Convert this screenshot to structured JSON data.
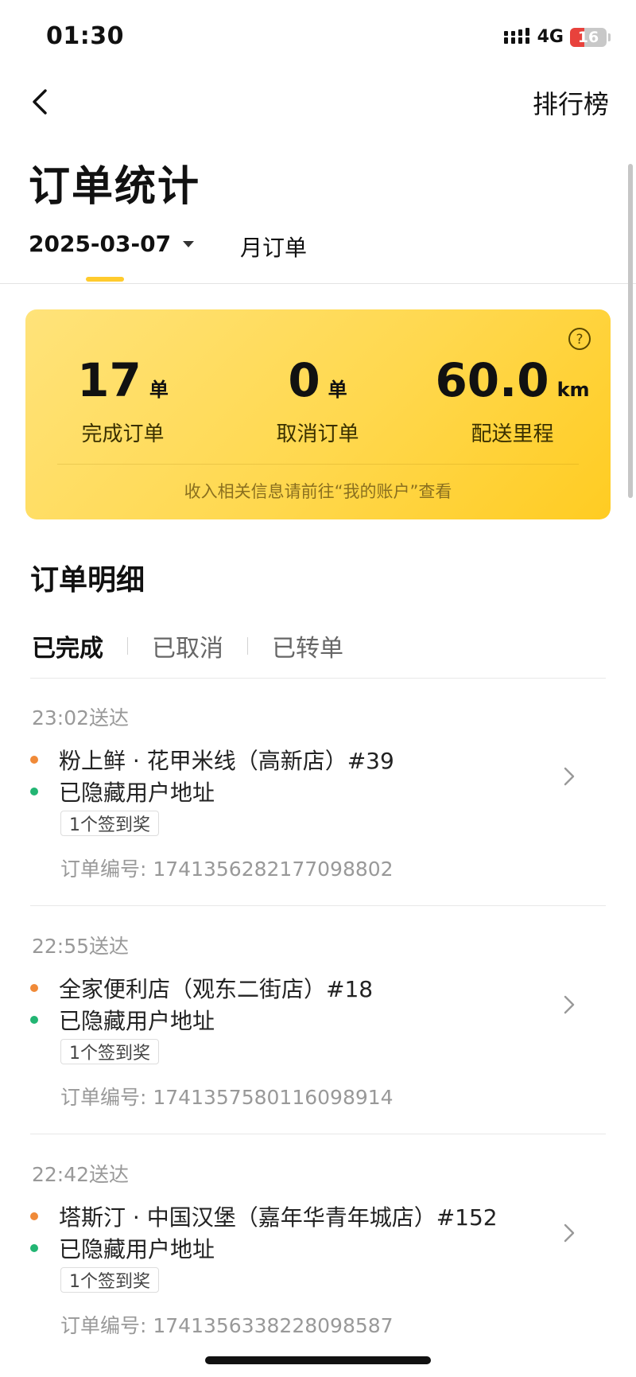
{
  "status_bar": {
    "time": "01:30",
    "network": "4G",
    "battery": "16",
    "battery_level": 0.16,
    "colors": {
      "battery_low": "#e8423c"
    }
  },
  "nav": {
    "back_icon": "chevron-left-icon",
    "ranking_label": "排行榜"
  },
  "page": {
    "title": "订单统计"
  },
  "tabs": {
    "date": "2025-03-07",
    "month": "月订单",
    "active": "date",
    "accent_color": "#ffcb2d"
  },
  "summary": {
    "stats": [
      {
        "value": "17",
        "unit": "单",
        "label": "完成订单"
      },
      {
        "value": "0",
        "unit": "单",
        "label": "取消订单"
      },
      {
        "value": "60.0",
        "unit": "km",
        "label": "配送里程"
      }
    ],
    "note": "收入相关信息请前往“我的账户”查看",
    "help_icon": "question-circle-icon",
    "card_color": "#ffd84e"
  },
  "detail": {
    "title": "订单明细",
    "filters": [
      "已完成",
      "已取消",
      "已转单"
    ],
    "active_filter": 0
  },
  "orders": [
    {
      "time": "23:02送达",
      "store": "粉上鲜 · 花甲米线（高新店）#39",
      "address": "已隐藏用户地址",
      "badge": "1个签到奖",
      "order_no": "订单编号: 1741356282177098802"
    },
    {
      "time": "22:55送达",
      "store": "全家便利店（观东二街店）#18",
      "address": "已隐藏用户地址",
      "badge": "1个签到奖",
      "order_no": "订单编号: 1741357580116098914"
    },
    {
      "time": "22:42送达",
      "store": "塔斯汀 · 中国汉堡（嘉年华青年城店）#152",
      "address": "已隐藏用户地址",
      "badge": "1个签到奖",
      "order_no": "订单编号: 1741356338228098587"
    }
  ],
  "colors": {
    "pickup_dot": "#f08a38",
    "delivery_dot": "#22b573"
  }
}
